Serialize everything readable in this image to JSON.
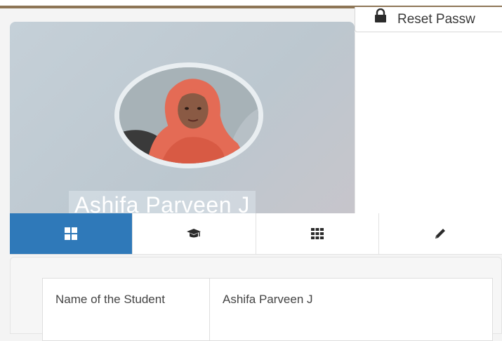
{
  "toolbar": {
    "reset_password_label": "Reset Passw",
    "lock_icon": "lock-icon"
  },
  "profile": {
    "name": "Ashifa Parveen J",
    "avatar": "student-photo"
  },
  "tabs": [
    {
      "icon": "dashboard-grid-icon",
      "active": true
    },
    {
      "icon": "graduation-cap-icon",
      "active": false
    },
    {
      "icon": "apps-grid-icon",
      "active": false
    },
    {
      "icon": "pencil-icon",
      "active": false
    }
  ],
  "details": {
    "rows": [
      {
        "label": "Name of the Student",
        "value": "Ashifa Parveen J"
      }
    ]
  },
  "colors": {
    "active_tab": "#2f79b9",
    "card_background": "#c5d0d8",
    "top_border": "#8d7556"
  }
}
